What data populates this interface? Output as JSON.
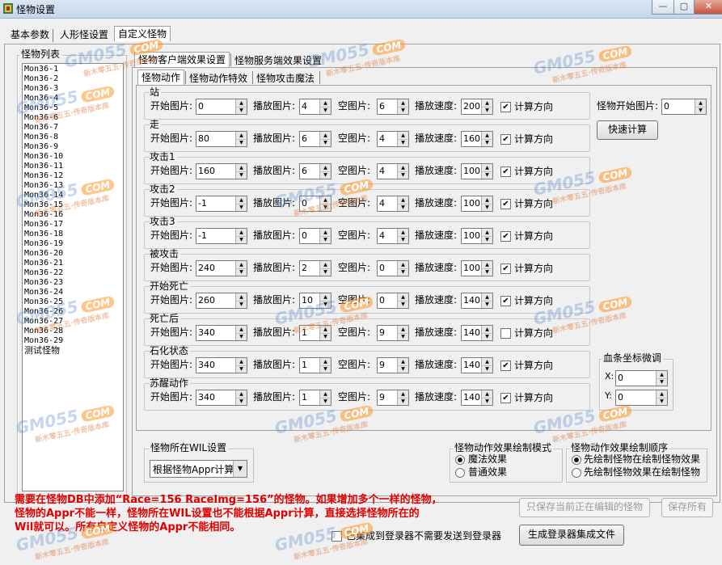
{
  "window": {
    "title": "怪物设置"
  },
  "top_tabs": [
    "基本参数",
    "人形怪设置",
    "自定义怪物"
  ],
  "monster_list": {
    "legend": "怪物列表",
    "items": [
      "Mon36-1",
      "Mon36-2",
      "Mon36-3",
      "Mon36-4",
      "Mon36-5",
      "Mon36-6",
      "Mon36-7",
      "Mon36-8",
      "Mon36-9",
      "Mon36-10",
      "Mon36-11",
      "Mon36-12",
      "Mon36-13",
      "Mon36-14",
      "Mon36-15",
      "Mon36-16",
      "Mon36-17",
      "Mon36-18",
      "Mon36-19",
      "Mon36-20",
      "Mon36-21",
      "Mon36-22",
      "Mon36-23",
      "Mon36-24",
      "Mon36-25",
      "Mon36-26",
      "Mon36-27",
      "Mon36-28",
      "Mon36-29",
      "测试怪物"
    ]
  },
  "sub_tabs": [
    "怪物客户端效果设置",
    "怪物服务端效果设置"
  ],
  "inner_tabs": [
    "怪物动作",
    "怪物动作特效",
    "怪物攻击魔法"
  ],
  "field_labels": {
    "start": "开始图片:",
    "play": "播放图片:",
    "empty": "空图片:",
    "speed": "播放速度:",
    "calc_dir": "计算方向"
  },
  "actions": [
    {
      "name": "站",
      "start": "0",
      "play": "4",
      "empty": "6",
      "speed": "200",
      "calc": true
    },
    {
      "name": "走",
      "start": "80",
      "play": "6",
      "empty": "4",
      "speed": "160",
      "calc": true
    },
    {
      "name": "攻击1",
      "start": "160",
      "play": "6",
      "empty": "4",
      "speed": "100",
      "calc": true
    },
    {
      "name": "攻击2",
      "start": "-1",
      "play": "0",
      "empty": "4",
      "speed": "100",
      "calc": true
    },
    {
      "name": "攻击3",
      "start": "-1",
      "play": "0",
      "empty": "4",
      "speed": "100",
      "calc": true
    },
    {
      "name": "被攻击",
      "start": "240",
      "play": "2",
      "empty": "0",
      "speed": "100",
      "calc": true
    },
    {
      "name": "开始死亡",
      "start": "260",
      "play": "10",
      "empty": "0",
      "speed": "140",
      "calc": true
    },
    {
      "name": "死亡后",
      "start": "340",
      "play": "1",
      "empty": "9",
      "speed": "140",
      "calc": false
    },
    {
      "name": "石化状态",
      "start": "340",
      "play": "1",
      "empty": "9",
      "speed": "140",
      "calc": true
    },
    {
      "name": "苏醒动作",
      "start": "340",
      "play": "1",
      "empty": "9",
      "speed": "140",
      "calc": true
    }
  ],
  "monster_start": {
    "label": "怪物开始图片:",
    "value": "0"
  },
  "quick_calc": "快速计算",
  "hp_bar": {
    "legend": "血条坐标微调",
    "x_label": "X:",
    "x_value": "0",
    "y_label": "Y:",
    "y_value": "0"
  },
  "wil_setting": {
    "legend": "怪物所在WIL设置",
    "selected": "根据怪物Appr计算"
  },
  "draw_mode": {
    "legend": "怪物动作效果绘制模式",
    "options": [
      "魔法效果",
      "普通效果"
    ],
    "selected_index": 0
  },
  "draw_order": {
    "legend": "怪物动作效果绘制顺序",
    "options": [
      "先绘制怪物在绘制怪物效果",
      "先绘制怪物效果在绘制怪物"
    ],
    "selected_index": 0
  },
  "note_lines": [
    "需要在怪物DB中添加“Race=156 RaceImg=156”的怪物。如果增加多个一样的怪物，",
    "怪物的Appr不能一样，怪物所在WIL设置也不能根据Appr计算，直接选择怪物所在的",
    "Wil就可以。所有自定义怪物的Appr不能相同。"
  ],
  "buttons": {
    "save_current": "只保存当前正在编辑的怪物",
    "save_all": "保存所有",
    "generate": "生成登录器集成文件"
  },
  "integrated_checkbox": {
    "label": "已集成到登录器不需要发送到登录器",
    "checked": false
  },
  "watermark": {
    "brand": "GM055",
    "badge": "COM",
    "sub": "新木零五五·传奇版本库"
  },
  "colors": {
    "note_red": "#e00000",
    "watermark_blue": "#5a8cd2",
    "watermark_orange": "#ff9628"
  }
}
